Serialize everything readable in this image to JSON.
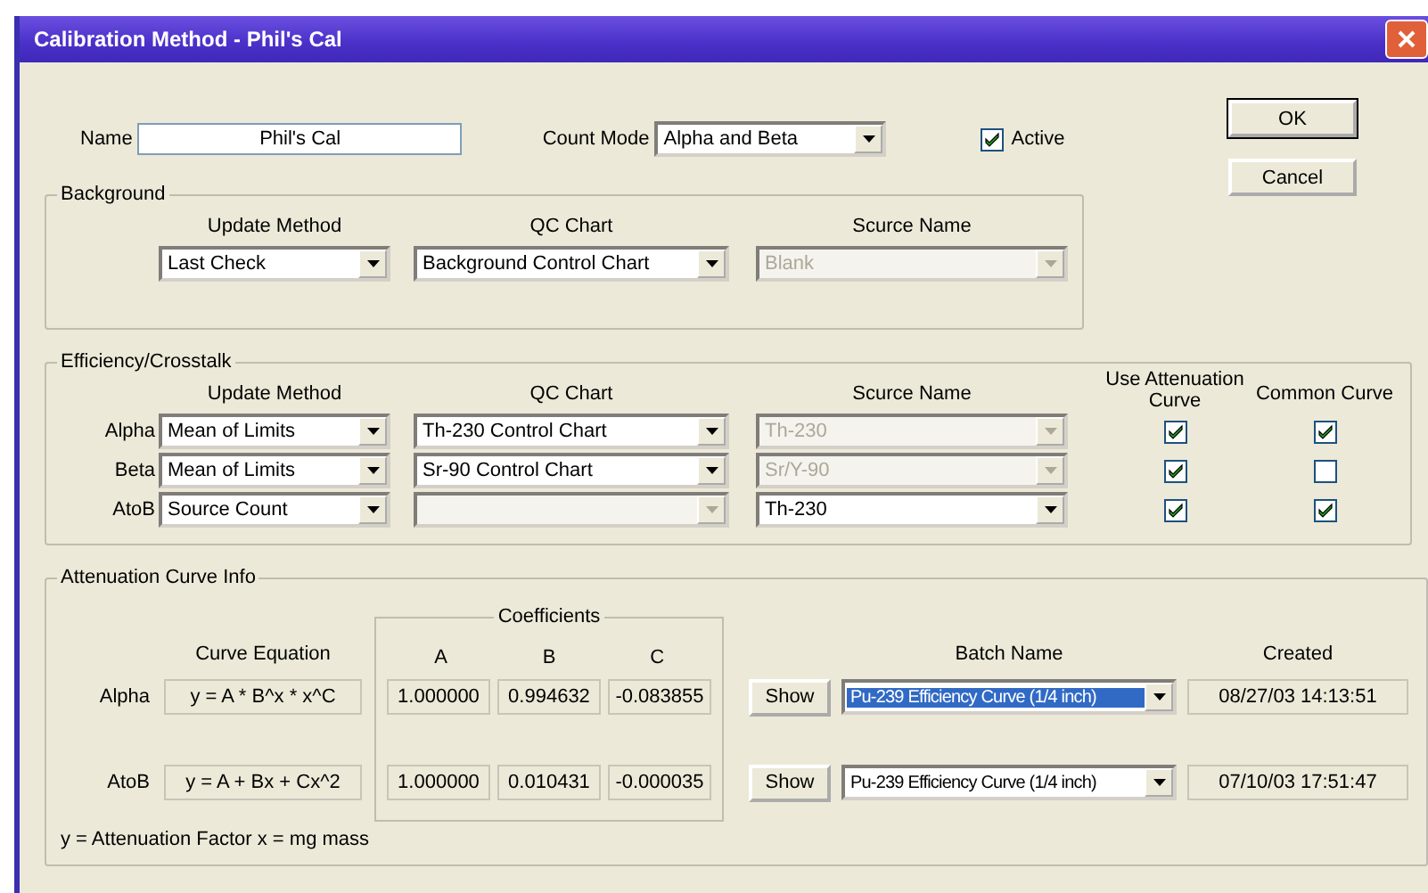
{
  "window": {
    "title": "Calibration Method - Phil's Cal"
  },
  "name": {
    "label": "Name",
    "value": "Phil's Cal"
  },
  "count_mode": {
    "label": "Count Mode",
    "value": "Alpha and Beta"
  },
  "active": {
    "label": "Active",
    "checked": true
  },
  "buttons": [
    "OK",
    "Cancel"
  ],
  "background": {
    "title": "Background",
    "columns": [
      "Update Method",
      "QC Chart",
      "Scurce Name"
    ],
    "fields": [
      {
        "value": "Last Check",
        "disabled": false
      },
      {
        "value": "Background Control Chart",
        "disabled": false
      },
      {
        "value": "Blank",
        "disabled": true
      }
    ]
  },
  "efficiency": {
    "title": "Efficiency/Crosstalk",
    "columns": [
      "Update Method",
      "QC Chart",
      "Scurce Name",
      "Use Attenuation Curve",
      "Common Curve"
    ],
    "rows": [
      {
        "label": "Alpha",
        "update_method": {
          "value": "Mean of Limits",
          "disabled": false
        },
        "qc_chart": {
          "value": "Th-230 Control Chart",
          "disabled": false
        },
        "source_name": {
          "value": "Th-230",
          "disabled": true
        },
        "use_attenuation_curve": true,
        "common_curve": true
      },
      {
        "label": "Beta",
        "update_method": {
          "value": "Mean of Limits",
          "disabled": false
        },
        "qc_chart": {
          "value": "Sr-90 Control Chart",
          "disabled": false
        },
        "source_name": {
          "value": "Sr/Y-90",
          "disabled": true
        },
        "use_attenuation_curve": true,
        "common_curve": false
      },
      {
        "label": "AtoB",
        "update_method": {
          "value": "Source Count",
          "disabled": false
        },
        "qc_chart": {
          "disabled": true
        },
        "source_name": {
          "value": "Th-230",
          "disabled": false
        },
        "use_attenuation_curve": true,
        "common_curve": true
      }
    ]
  },
  "attenuation": {
    "title": "Attenuation Curve Info",
    "coefficients_title": "Coefficients",
    "columns": {
      "equation": "Curve Equation",
      "a": "A",
      "b": "B",
      "c": "C",
      "batch": "Batch Name",
      "created": "Created"
    },
    "rows": [
      {
        "label": "Alpha",
        "equation": "y = A * B^x * x^C",
        "a": "1.000000",
        "b": "0.994632",
        "c": "-0.083855",
        "show": "Show",
        "batch_name": {
          "value": "Pu-239 Efficiency Curve (1/4 inch)",
          "selected": true
        },
        "created": "08/27/03 14:13:51"
      },
      {
        "label": "AtoB",
        "equation": "y = A + Bx + Cx^2",
        "a": "1.000000",
        "b": "0.010431",
        "c": "-0.000035",
        "show": "Show",
        "batch_name": {
          "value": "Pu-239 Efficiency Curve (1/4 inch)",
          "selected": false
        },
        "created": "07/10/03 17:51:47"
      }
    ],
    "footnote": "y = Attenuation Factor  x = mg mass"
  }
}
